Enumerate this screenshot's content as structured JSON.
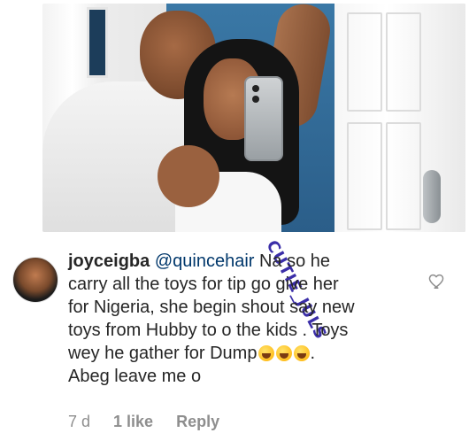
{
  "comment": {
    "username": "joyceigba",
    "mention": "@quincehair",
    "text_lines": [
      "Na so he",
      "carry all the toys for tip go give her",
      "for Nigeria, she begin shout say new",
      "toys from Hubby to o the kids . Toys",
      "wey he gather for Dump",
      ".",
      "Abeg leave me o"
    ],
    "emoji_count": 3,
    "time": "7 d",
    "likes": "1 like",
    "reply": "Reply"
  },
  "watermark": "CUTIE_JULS",
  "colors": {
    "mention": "#00376b",
    "text": "#262626",
    "meta": "#8e8e8e",
    "watermark": "#3b2ea8"
  }
}
